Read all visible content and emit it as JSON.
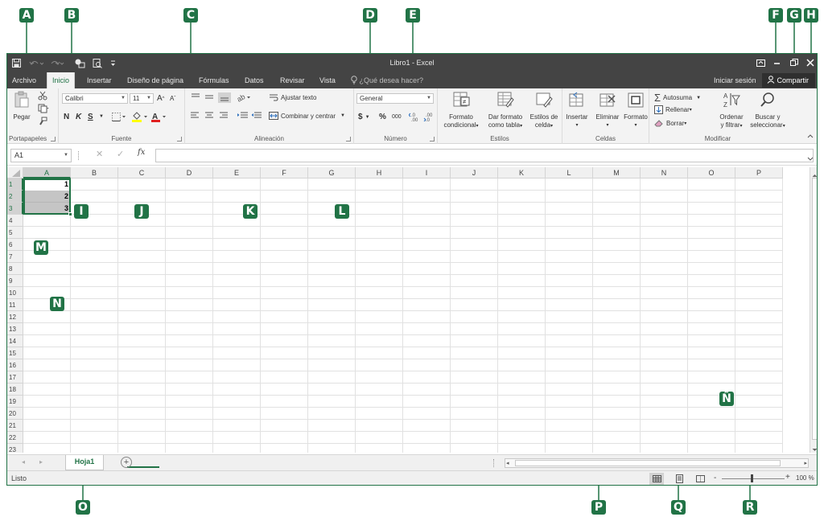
{
  "colors": {
    "excel_green": "#217346",
    "title_bar": "#444444",
    "ribbon_bg": "#f3f3f3"
  },
  "titlebar": {
    "title": "Libro1 - Excel",
    "qat_icons": [
      "save-icon",
      "undo-icon",
      "redo-icon",
      "touch-mode-icon",
      "print-preview-icon",
      "customize-icon"
    ],
    "window_icons": [
      "ribbon-display-icon",
      "minimize-icon",
      "restore-icon",
      "close-icon"
    ]
  },
  "tabs": {
    "file": "Archivo",
    "items": [
      "Inicio",
      "Insertar",
      "Diseño de página",
      "Fórmulas",
      "Datos",
      "Revisar",
      "Vista"
    ],
    "active": "Inicio",
    "tell_me": "¿Qué desea hacer?",
    "sign_in": "Iniciar sesión",
    "share": "Compartir"
  },
  "ribbon": {
    "clipboard": {
      "paste": "Pegar",
      "label": "Portapapeles"
    },
    "font": {
      "name": "Calibri",
      "size": "11",
      "bold": "N",
      "italic": "K",
      "underline": "S",
      "label": "Fuente"
    },
    "alignment": {
      "wrap": "Ajustar texto",
      "merge": "Combinar y centrar",
      "label": "Alineación"
    },
    "number": {
      "format": "General",
      "currency": "$",
      "percent": "%",
      "thousands": "000",
      "label": "Número"
    },
    "styles": {
      "conditional": [
        "Formato",
        "condicional"
      ],
      "as_table": [
        "Dar formato",
        "como tabla"
      ],
      "cell_styles": [
        "Estilos de",
        "celda"
      ],
      "label": "Estilos"
    },
    "cells": {
      "insert": "Insertar",
      "delete": "Eliminar",
      "format": "Formato",
      "label": "Celdas"
    },
    "editing": {
      "autosum": "Autosuma",
      "fill": "Rellenar",
      "clear": "Borrar",
      "sort": [
        "Ordenar",
        "y filtrar"
      ],
      "find": [
        "Buscar y",
        "seleccionar"
      ],
      "label": "Modificar"
    }
  },
  "formula_bar": {
    "name_box": "A1",
    "fx": "fx",
    "value": ""
  },
  "grid": {
    "columns": [
      "A",
      "B",
      "C",
      "D",
      "E",
      "F",
      "G",
      "H",
      "I",
      "J",
      "K",
      "L",
      "M",
      "N",
      "O",
      "P"
    ],
    "rows": [
      "1",
      "2",
      "3",
      "4",
      "5",
      "6",
      "7",
      "8",
      "9",
      "10",
      "11",
      "12",
      "13",
      "14",
      "15",
      "16",
      "17",
      "18",
      "19",
      "20",
      "21",
      "22",
      "23"
    ],
    "values_col_a": [
      "1",
      "2",
      "3"
    ],
    "selected_column": "A",
    "selected_rows": [
      "1",
      "2",
      "3"
    ]
  },
  "sheets": {
    "tabs": [
      "Hoja1"
    ],
    "active": "Hoja1"
  },
  "status": {
    "text": "Listo",
    "zoom": "100 %",
    "zoom_minus": "-",
    "zoom_plus": "+"
  },
  "callouts": [
    "A",
    "B",
    "C",
    "D",
    "E",
    "F",
    "G",
    "H",
    "I",
    "J",
    "K",
    "L",
    "M",
    "N",
    "Ñ",
    "O",
    "P",
    "Q",
    "R"
  ]
}
